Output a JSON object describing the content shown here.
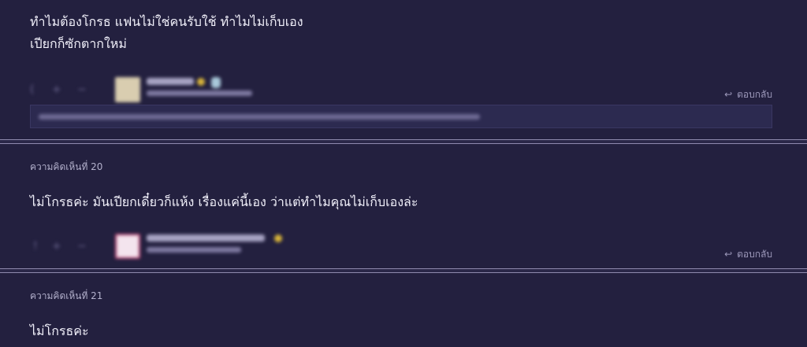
{
  "comments": [
    {
      "body_lines": [
        "ทำไมต้องโกรธ แฟนไม่ใช่คนรับใช้ ทำไมไม่เก็บเอง",
        "เปียกก็ซักตากใหม่"
      ],
      "reply_label": "ตอบกลับ"
    },
    {
      "header": "ความคิดเห็นที่ 20",
      "body_lines": [
        "ไม่โกรธค่ะ มันเปียกเดี๋ยวก็แห้ง เรื่องแค่นี้เอง ว่าแต่ทำไมคุณไม่เก็บเองล่ะ"
      ],
      "reply_label": "ตอบกลับ"
    },
    {
      "header": "ความคิดเห็นที่ 21",
      "body_lines": [
        "ไม่โกรธค่ะ"
      ]
    }
  ],
  "icons": {
    "reply": "reply-arrow-icon",
    "upvote": "plus-icon",
    "downvote": "minus-icon",
    "emotion": "emotion-icon"
  },
  "colors": {
    "background": "#23203f",
    "divider": "#8f8aae",
    "quote_box": "#2c2a50",
    "text": "#f1f0fa",
    "muted": "#9d99bb"
  }
}
